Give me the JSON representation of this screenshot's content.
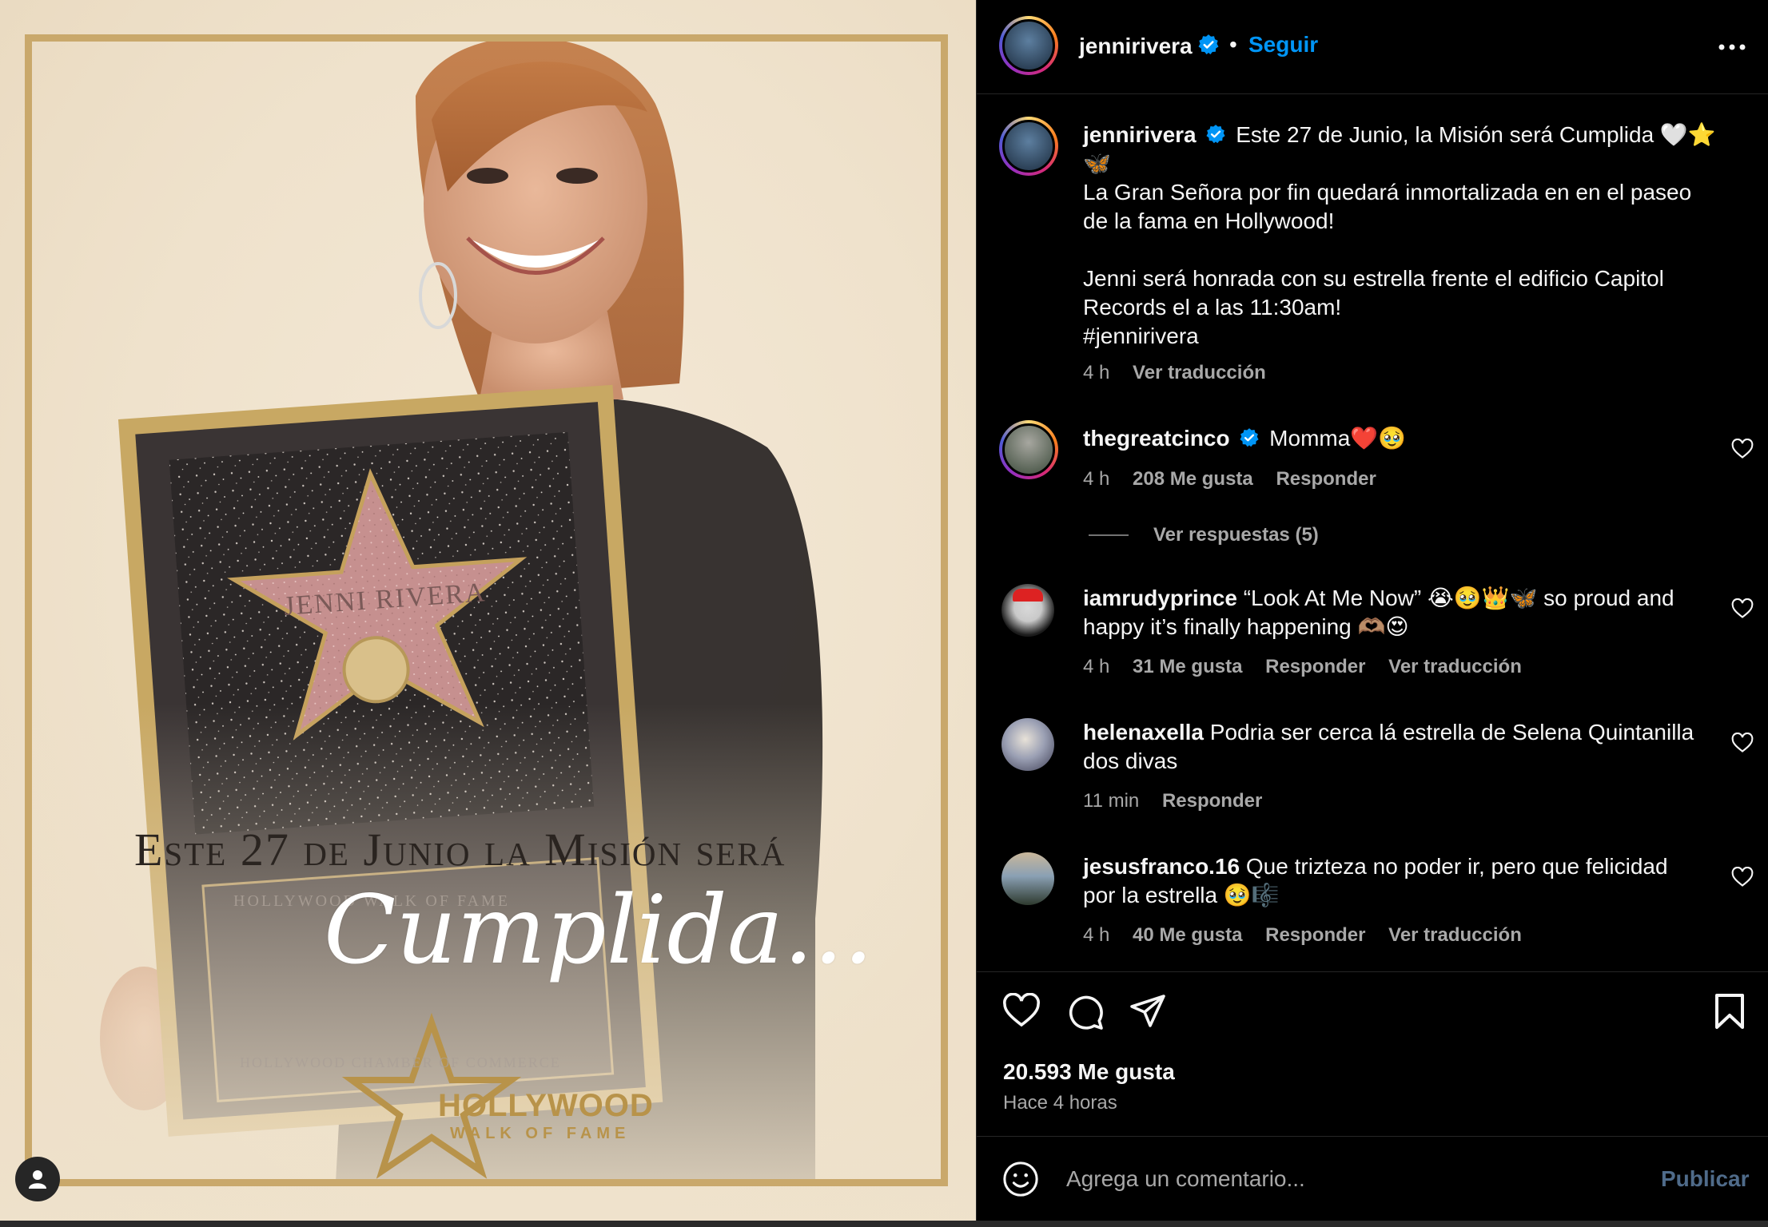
{
  "media": {
    "poster_line1": "Este 27 de Junio la Misión será",
    "poster_line2": "Cumplida...",
    "star_name": "JENNI RIVERA",
    "plaque_line1": "HOLLYWOOD WALK OF FAME",
    "plaque_line2": "HOLLYWOOD CHAMBER OF COMMERCE",
    "logo_title": "HOLLYWOOD",
    "logo_subtitle": "WALK OF FAME",
    "accent_gold": "#c9a86b"
  },
  "header": {
    "username": "jennirivera",
    "separator": "•",
    "follow_label": "Seguir",
    "more_icon": "more-horizontal-icon"
  },
  "caption": {
    "username": "jennirivera",
    "line1": "Este 27 de Junio, la Misión será Cumplida 🤍⭐",
    "line1b": "🦋",
    "line2": "La Gran Señora por fin quedará inmortalizada en en el paseo",
    "line3": "de la fama en Hollywood!",
    "line4": "Jenni será honrada con su estrella frente el edificio Capitol",
    "line5": "Records el a las 11:30am!",
    "hashtag": "#jennirivera",
    "time": "4 h",
    "translate": "Ver traducción"
  },
  "comments": [
    {
      "username": "thegreatcinco",
      "verified": true,
      "text": "Momma❤️🥹",
      "time": "4 h",
      "likes": "208 Me gusta",
      "reply": "Responder",
      "view_replies": "Ver respuestas (5)"
    },
    {
      "username": "iamrudyprince",
      "text": "“Look At Me Now” 😭🥹👑🦋 so proud and",
      "text2": "happy it’s finally happening 🫶🏽😍",
      "time": "4 h",
      "likes": "31 Me gusta",
      "reply": "Responder",
      "translate": "Ver traducción"
    },
    {
      "username": "helenaxella",
      "text": "Podria ser cerca lá estrella de Selena Quintanilla",
      "text2": "dos divas",
      "time": "11 min",
      "reply": "Responder"
    },
    {
      "username": "jesusfranco.16",
      "text": "Que trizteza no poder ir, pero que felicidad",
      "text2": "por la estrella 🥹🎼",
      "time": "4 h",
      "likes": "40 Me gusta",
      "reply": "Responder",
      "translate": "Ver traducción"
    }
  ],
  "actions": {
    "likes": "20.593 Me gusta",
    "posted": "Hace 4 horas"
  },
  "comment_box": {
    "placeholder": "Agrega un comentario...",
    "publish": "Publicar"
  },
  "colors": {
    "link_blue": "#0095f6",
    "verified_blue": "#0095f6",
    "muted_text": "#a8a8a8",
    "background": "#000000"
  }
}
